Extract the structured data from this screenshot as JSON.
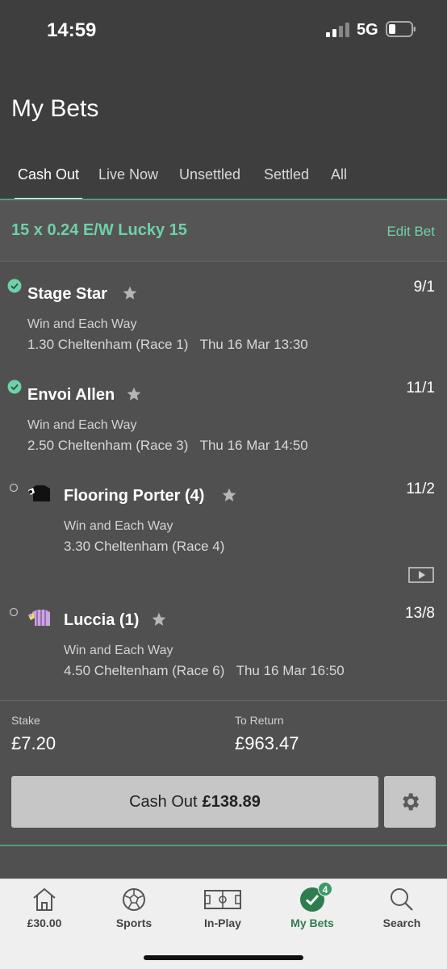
{
  "status_bar": {
    "time": "14:59",
    "network": "5G"
  },
  "header": {
    "title": "My Bets"
  },
  "tabs": [
    {
      "label": "Cash Out",
      "active": true
    },
    {
      "label": "Live Now",
      "active": false
    },
    {
      "label": "Unsettled",
      "active": false
    },
    {
      "label": "Settled",
      "active": false
    },
    {
      "label": "All",
      "active": false
    }
  ],
  "bet": {
    "title": "15 x 0.24 E/W Lucky 15",
    "edit_label": "Edit Bet",
    "selections": [
      {
        "name": "Stage Star",
        "odds": "9/1",
        "market": "Win and Each Way",
        "race": "1.30 Cheltenham (Race 1)",
        "datetime": "Thu 16 Mar 13:30",
        "status": "won"
      },
      {
        "name": "Envoi Allen",
        "odds": "11/1",
        "market": "Win and Each Way",
        "race": "2.50 Cheltenham (Race 3)",
        "datetime": "Thu 16 Mar 14:50",
        "status": "won"
      },
      {
        "name": "Flooring Porter (4)",
        "odds": "11/2",
        "market": "Win and Each Way",
        "race": "3.30 Cheltenham (Race 4)",
        "datetime": "",
        "status": "open"
      },
      {
        "name": "Luccia (1)",
        "odds": "13/8",
        "market": "Win and Each Way",
        "race": "4.50 Cheltenham (Race 6)",
        "datetime": "Thu 16 Mar 16:50",
        "status": "open"
      }
    ],
    "stake_label": "Stake",
    "stake_value": "£7.20",
    "return_label": "To Return",
    "return_value": "£963.47",
    "cashout_label": "Cash Out",
    "cashout_value": "£138.89"
  },
  "tabbar": [
    {
      "label": "£30.00",
      "icon": "home-icon"
    },
    {
      "label": "Sports",
      "icon": "football-icon"
    },
    {
      "label": "In-Play",
      "icon": "pitch-icon"
    },
    {
      "label": "My Bets",
      "icon": "check-circle-icon",
      "badge": "4",
      "active": true
    },
    {
      "label": "Search",
      "icon": "search-icon"
    }
  ],
  "colors": {
    "accent": "#6fd1a8",
    "bg": "#505050",
    "header": "#3e3e3e",
    "active_tab": "#2e7d4f"
  }
}
